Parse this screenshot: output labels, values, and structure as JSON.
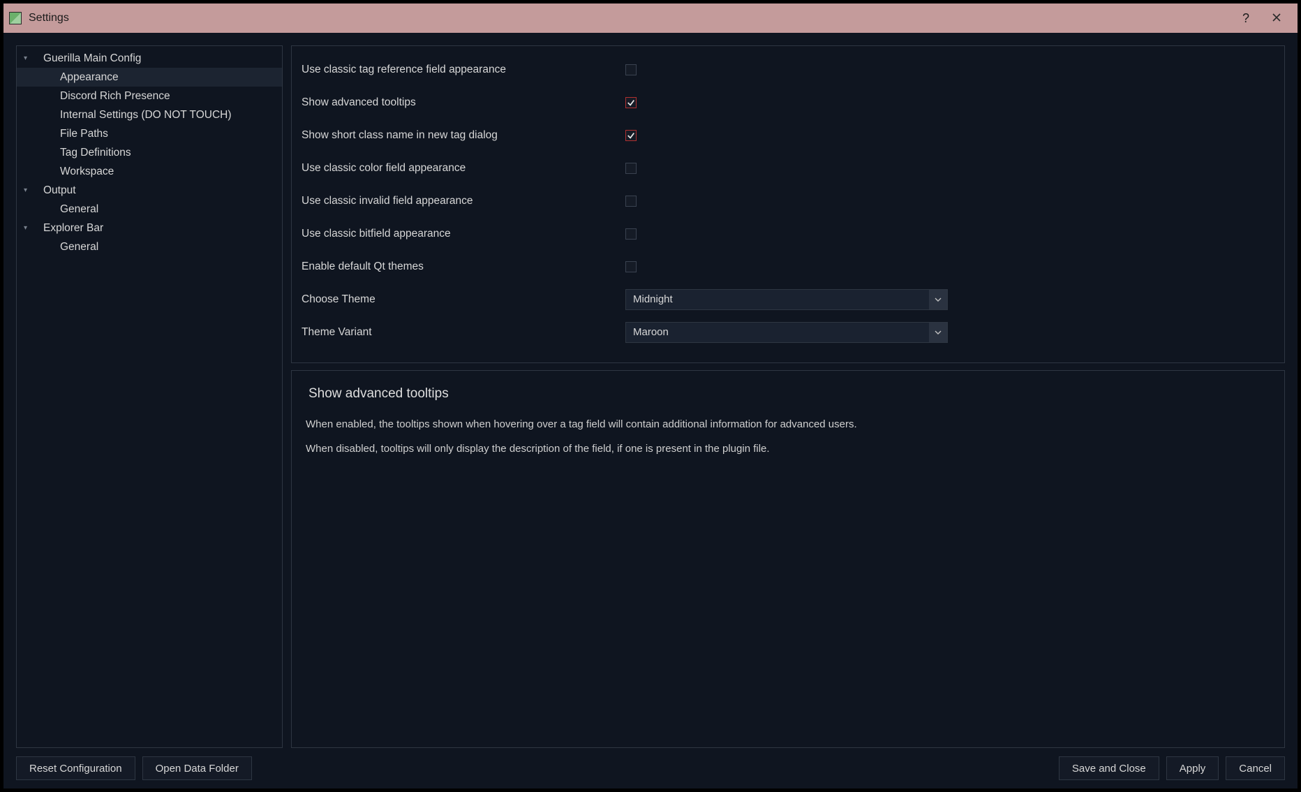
{
  "window": {
    "title": "Settings"
  },
  "sidebar": {
    "groups": [
      {
        "label": "Guerilla Main Config",
        "items": [
          {
            "label": "Appearance",
            "selected": true
          },
          {
            "label": "Discord Rich Presence"
          },
          {
            "label": "Internal Settings (DO NOT TOUCH)"
          },
          {
            "label": "File Paths"
          },
          {
            "label": "Tag Definitions"
          },
          {
            "label": "Workspace"
          }
        ]
      },
      {
        "label": "Output",
        "items": [
          {
            "label": "General"
          }
        ]
      },
      {
        "label": "Explorer Bar",
        "items": [
          {
            "label": "General"
          }
        ]
      }
    ]
  },
  "settings": {
    "rows": [
      {
        "label": "Use classic tag reference field appearance",
        "type": "check",
        "checked": false
      },
      {
        "label": "Show advanced tooltips",
        "type": "check",
        "checked": true
      },
      {
        "label": "Show short class name in new tag dialog",
        "type": "check",
        "checked": true
      },
      {
        "label": "Use classic color field appearance",
        "type": "check",
        "checked": false
      },
      {
        "label": "Use classic invalid field appearance",
        "type": "check",
        "checked": false
      },
      {
        "label": "Use classic bitfield appearance",
        "type": "check",
        "checked": false
      },
      {
        "label": "Enable default Qt themes",
        "type": "check",
        "checked": false
      },
      {
        "label": "Choose Theme",
        "type": "combo",
        "value": "Midnight"
      },
      {
        "label": "Theme Variant",
        "type": "combo",
        "value": "Maroon"
      }
    ]
  },
  "help": {
    "title": "Show advanced tooltips",
    "paragraphs": [
      "When enabled, the tooltips shown when hovering over a tag field will contain additional information for advanced users.",
      "When disabled, tooltips will only display the description of the field, if one is present in the plugin file."
    ]
  },
  "footer": {
    "reset": "Reset Configuration",
    "open_data": "Open Data Folder",
    "save_close": "Save and Close",
    "apply": "Apply",
    "cancel": "Cancel"
  }
}
